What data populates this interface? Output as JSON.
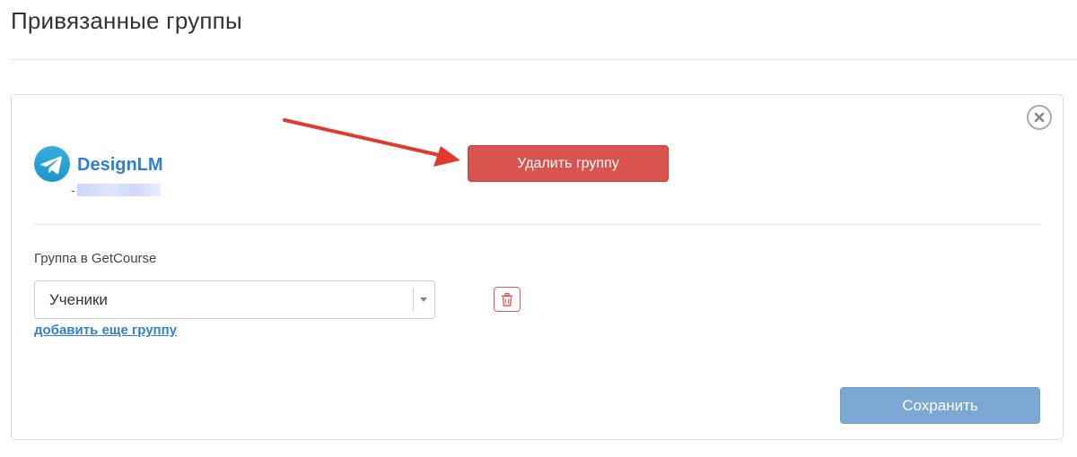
{
  "page": {
    "title": "Привязанные группы"
  },
  "group": {
    "name": "DesignLM",
    "id_prefix": "-",
    "platform_icon": "telegram-icon",
    "delete_button_label": "Удалить группу"
  },
  "getcourse": {
    "field_label": "Группа в GetCourse",
    "selected_group": "Ученики",
    "add_group_link": "добавить еще группу"
  },
  "actions": {
    "save_label": "Сохранить"
  },
  "icons": {
    "close": "close-icon",
    "trash": "trash-icon",
    "dropdown": "chevron-down-icon",
    "annotation": "arrow-icon"
  },
  "colors": {
    "danger": "#d9534f",
    "link": "#2f7fd6",
    "save_disabled": "#7ba7d3",
    "telegram": "#2ea6e0",
    "annotation_arrow": "#e03a2f"
  }
}
